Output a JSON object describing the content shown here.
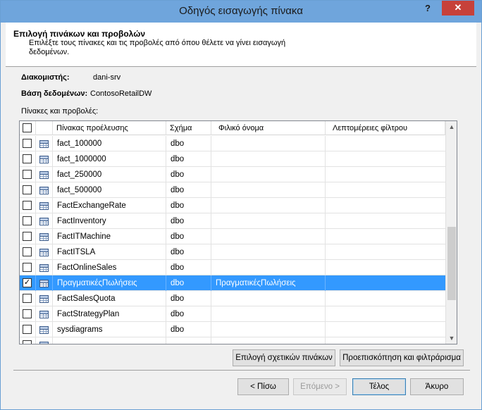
{
  "window": {
    "title": "Οδηγός εισαγωγής πίνακα",
    "help_label": "?",
    "close_label": "✕"
  },
  "header": {
    "title": "Επιλογή πινάκων και προβολών",
    "description": "Επιλέξτε τους πίνακες και τις προβολές από όπου θέλετε να γίνει εισαγωγή δεδομένων."
  },
  "connection": {
    "server_label": "Διακομιστής:",
    "server_value": "dani-srv",
    "database_label": "Βάση δεδομένων:",
    "database_value": "ContosoRetailDW",
    "list_label": "Πίνακες και προβολές:"
  },
  "grid": {
    "columns": [
      "Πίνακας προέλευσης",
      "Σχήμα",
      "Φιλικό όνομα",
      "Λεπτομέρειες φίλτρου"
    ],
    "rows": [
      {
        "source": "fact_100000",
        "schema": "dbo",
        "friendly": "",
        "filter": "",
        "checked": false,
        "selected": false
      },
      {
        "source": "fact_1000000",
        "schema": "dbo",
        "friendly": "",
        "filter": "",
        "checked": false,
        "selected": false
      },
      {
        "source": "fact_250000",
        "schema": "dbo",
        "friendly": "",
        "filter": "",
        "checked": false,
        "selected": false
      },
      {
        "source": "fact_500000",
        "schema": "dbo",
        "friendly": "",
        "filter": "",
        "checked": false,
        "selected": false
      },
      {
        "source": "FactExchangeRate",
        "schema": "dbo",
        "friendly": "",
        "filter": "",
        "checked": false,
        "selected": false
      },
      {
        "source": "FactInventory",
        "schema": "dbo",
        "friendly": "",
        "filter": "",
        "checked": false,
        "selected": false
      },
      {
        "source": "FactITMachine",
        "schema": "dbo",
        "friendly": "",
        "filter": "",
        "checked": false,
        "selected": false
      },
      {
        "source": "FactITSLA",
        "schema": "dbo",
        "friendly": "",
        "filter": "",
        "checked": false,
        "selected": false
      },
      {
        "source": "FactOnlineSales",
        "schema": "dbo",
        "friendly": "",
        "filter": "",
        "checked": false,
        "selected": false
      },
      {
        "source": "ΠραγματικέςΠωλήσεις",
        "schema": "dbo",
        "friendly": "ΠραγματικέςΠωλήσεις",
        "filter": "",
        "checked": true,
        "selected": true
      },
      {
        "source": "FactSalesQuota",
        "schema": "dbo",
        "friendly": "",
        "filter": "",
        "checked": false,
        "selected": false
      },
      {
        "source": "FactStrategyPlan",
        "schema": "dbo",
        "friendly": "",
        "filter": "",
        "checked": false,
        "selected": false
      },
      {
        "source": "sysdiagrams",
        "schema": "dbo",
        "friendly": "",
        "filter": "",
        "checked": false,
        "selected": false
      }
    ]
  },
  "buttons": {
    "select_related": "Επιλογή σχετικών πινάκων",
    "preview_filter": "Προεπισκόπηση και φιλτράρισμα",
    "back": "< Πίσω",
    "next": "Επόμενο >",
    "finish": "Τέλος",
    "cancel": "Άκυρο"
  }
}
